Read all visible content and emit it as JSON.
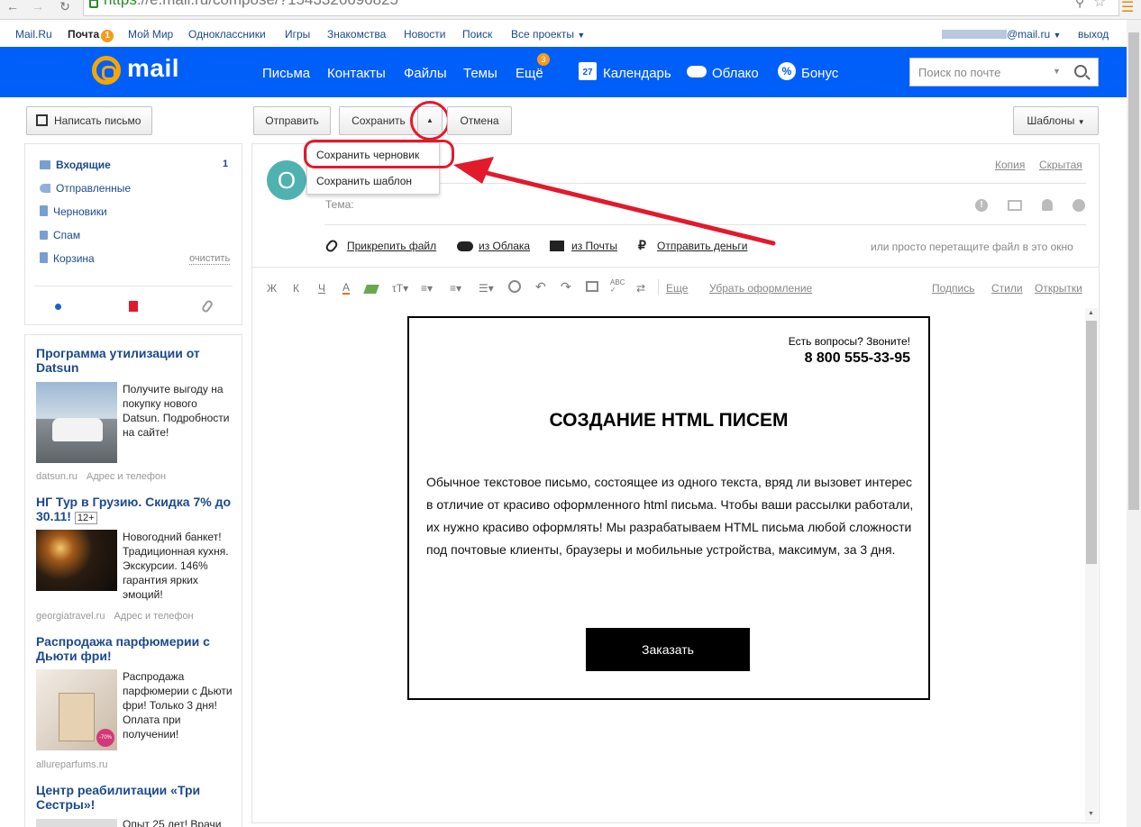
{
  "browser": {
    "url_scheme": "https",
    "url_rest": "://e.mail.ru/compose/?1543326696825"
  },
  "portal": {
    "items": [
      "Mail.Ru",
      "Почта",
      "Мой Мир",
      "Одноклассники",
      "Игры",
      "Знакомства",
      "Новости",
      "Поиск",
      "Все проекты"
    ],
    "mail_badge": "1",
    "account": "@mail.ru",
    "logout": "выход"
  },
  "header": {
    "logo": "mail",
    "nav": [
      "Письма",
      "Контакты",
      "Файлы",
      "Темы",
      "Ещё"
    ],
    "more_badge": "3",
    "calendar": "Календарь",
    "calendar_day": "27",
    "cloud": "Облако",
    "bonus": "Бонус",
    "search_placeholder": "Поиск по почте"
  },
  "toolbar": {
    "compose": "Написать письмо",
    "send": "Отправить",
    "save": "Сохранить",
    "cancel": "Отмена",
    "templates": "Шаблоны"
  },
  "dropdown": {
    "items": [
      "Сохранить черновик",
      "Сохранить шаблон"
    ]
  },
  "folders": {
    "items": [
      "Входящие",
      "Отправленные",
      "Черновики",
      "Спам",
      "Корзина"
    ],
    "inbox_count": "1",
    "clear": "очистить"
  },
  "ads": [
    {
      "title": "Программа утилизации от Datsun",
      "text": "Получите выгоду на покупку нового Datsun. Подробности на сайте!",
      "source": "datsun.ru",
      "addr": "Адрес и телефон"
    },
    {
      "title": "НГ Тур в Грузию. Скидка 7% до 30.11!",
      "age": "12+",
      "text": "Новогодний банкет! Традиционная кухня. Экскурсии. 146% гарантия ярких эмоций!",
      "source": "georgiatravel.ru",
      "addr": "Адрес и телефон"
    },
    {
      "title": "Распродажа парфюмерии с Дьюти фри!",
      "text": "Распродажа парфюмерии с Дьюти фри! Только 3 дня! Оплата при получении!",
      "source": "allureparfums.ru",
      "badge": "-70%"
    },
    {
      "title": "Центр реабилитации «Три Сестры»!",
      "text": "Опыт 25 лет! Врачи"
    }
  ],
  "compose": {
    "avatar_letter": "О",
    "copy": "Копия",
    "bcc": "Скрытая",
    "subject_label": "Тема:",
    "attach_file": "Прикрепить файл",
    "from_cloud": "из Облака",
    "from_mail": "из Почты",
    "send_money": "Отправить деньги",
    "drag_hint": "или просто перетащите файл в это окно",
    "fmt_bold": "Ж",
    "fmt_italic": "К",
    "fmt_underline": "Ч",
    "fmt_color": "А",
    "more": "Еще",
    "clear_format": "Убрать оформление",
    "signature": "Подпись",
    "styles": "Стили",
    "postcards": "Открытки"
  },
  "email": {
    "question": "Есть вопросы? Звоните!",
    "phone": "8 800 555-33-95",
    "heading": "СОЗДАНИЕ HTML ПИСЕМ",
    "body": "Обычное текстовое письмо, состоящее из одного текста, вряд ли вызовет интерес в отличие от красиво оформленного html письма. Чтобы ваши рассылки работали, их нужно красиво оформлять! Мы разрабатываем HTML письма любой сложности под почтовые клиенты, браузеры и мобильные устройства, максимум, за 3 дня.",
    "button": "Заказать"
  },
  "colors": {
    "brand_blue": "#005ff9",
    "accent_orange": "#f59b1c",
    "annotation_red": "#e3192c",
    "link_blue": "#1b4a8c"
  },
  "icons": [
    "back-icon",
    "forward-icon",
    "reload-icon",
    "lock-icon",
    "key-icon",
    "star-icon",
    "menu-icon",
    "search-icon",
    "calendar-icon",
    "cloud-icon",
    "bonus-icon",
    "pencil-icon",
    "inbox-icon",
    "sent-icon",
    "drafts-icon",
    "spam-icon",
    "trash-icon",
    "dot-icon",
    "bookmark-icon",
    "paperclip-icon",
    "important-icon",
    "envelope-icon",
    "bell-icon",
    "clock-icon",
    "ruble-icon",
    "smile-icon",
    "undo-icon",
    "redo-icon",
    "image-icon"
  ]
}
